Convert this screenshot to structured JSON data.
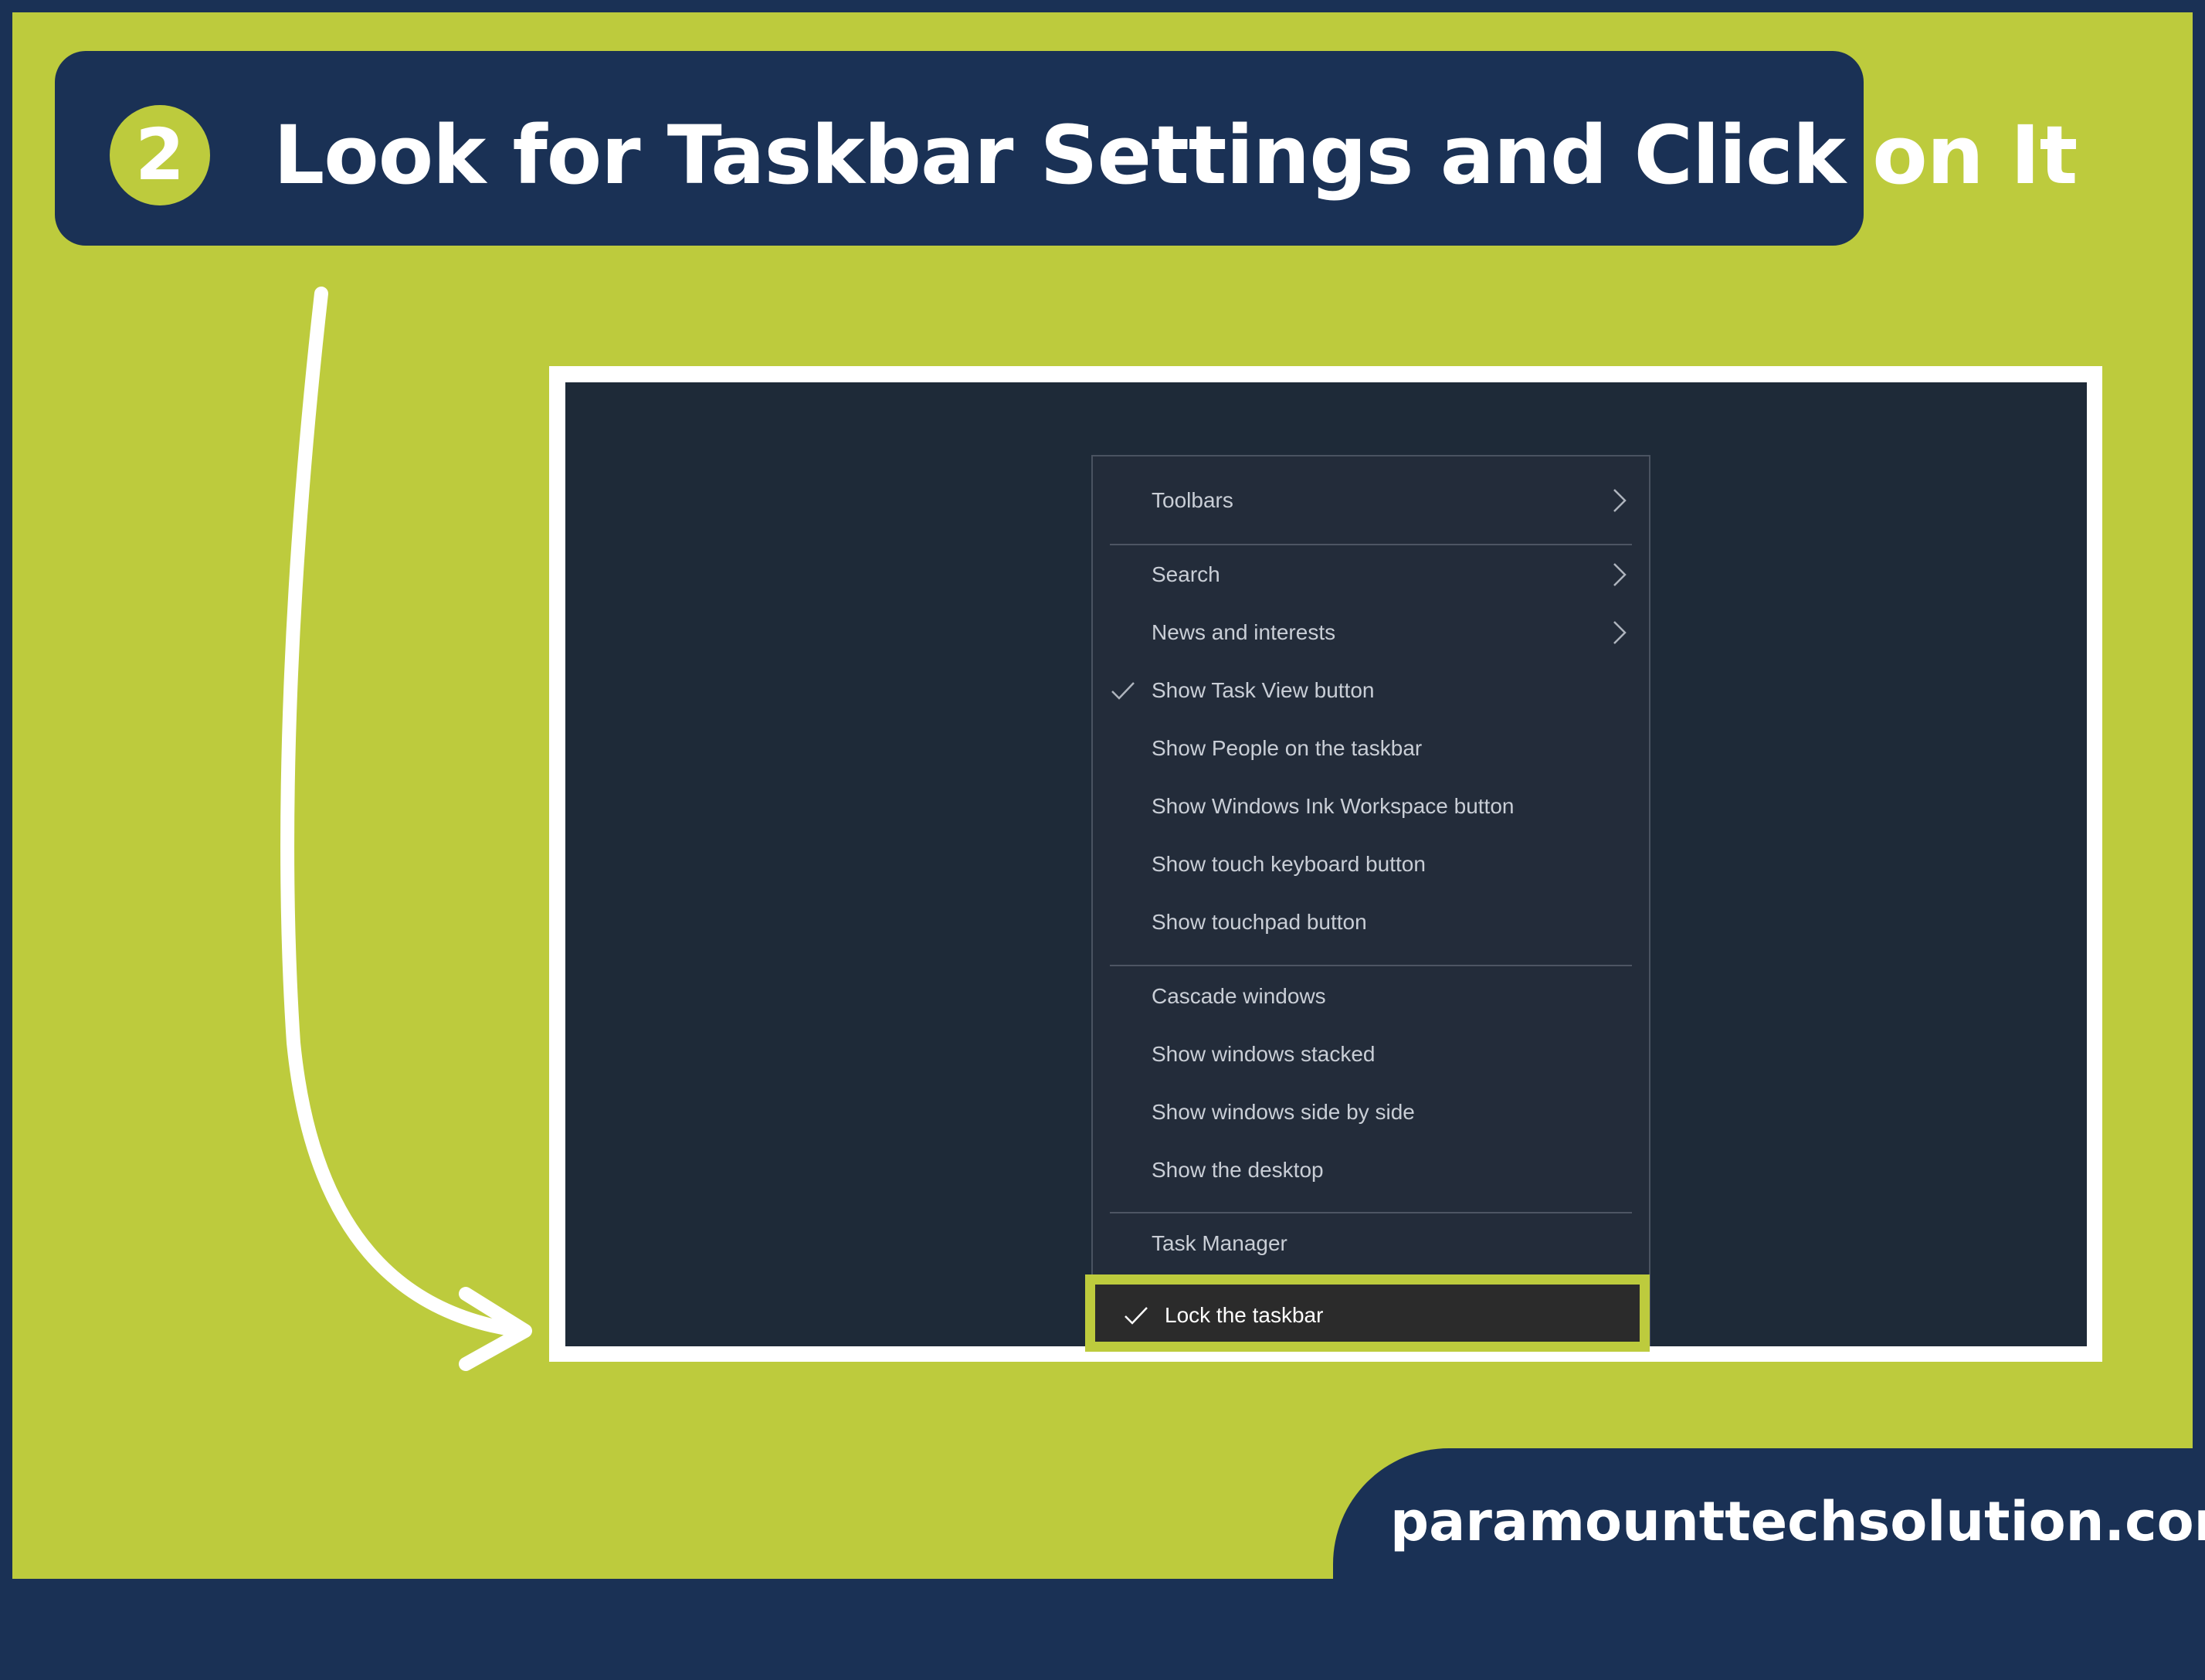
{
  "banner": {
    "step_number": "2",
    "title": "Look for Taskbar Settings and Click on It"
  },
  "context_menu": {
    "items": [
      {
        "label": "Toolbars",
        "checked": false,
        "submenu": true
      },
      {
        "label": "Search",
        "checked": false,
        "submenu": true
      },
      {
        "label": "News and interests",
        "checked": false,
        "submenu": true
      },
      {
        "label": "Show Task View button",
        "checked": true,
        "submenu": false
      },
      {
        "label": "Show People on the taskbar",
        "checked": false,
        "submenu": false
      },
      {
        "label": "Show Windows Ink Workspace button",
        "checked": false,
        "submenu": false
      },
      {
        "label": "Show touch keyboard button",
        "checked": false,
        "submenu": false
      },
      {
        "label": "Show touchpad button",
        "checked": false,
        "submenu": false
      },
      {
        "label": "Cascade windows",
        "checked": false,
        "submenu": false
      },
      {
        "label": "Show windows stacked",
        "checked": false,
        "submenu": false
      },
      {
        "label": "Show windows side by side",
        "checked": false,
        "submenu": false
      },
      {
        "label": "Show the desktop",
        "checked": false,
        "submenu": false
      },
      {
        "label": "Task Manager",
        "checked": false,
        "submenu": false
      },
      {
        "label": "Lock the taskbar",
        "checked": true,
        "submenu": false,
        "highlighted": true
      }
    ]
  },
  "footer": {
    "website": "paramounttechsolution.com"
  },
  "colors": {
    "accent_green": "#bdcb3d",
    "navy": "#1a3155",
    "screen_bg": "#1e2a38",
    "menu_bg": "#232c3a"
  },
  "icons": [
    "checkmark-icon",
    "chevron-right-icon",
    "curved-arrow-icon"
  ]
}
